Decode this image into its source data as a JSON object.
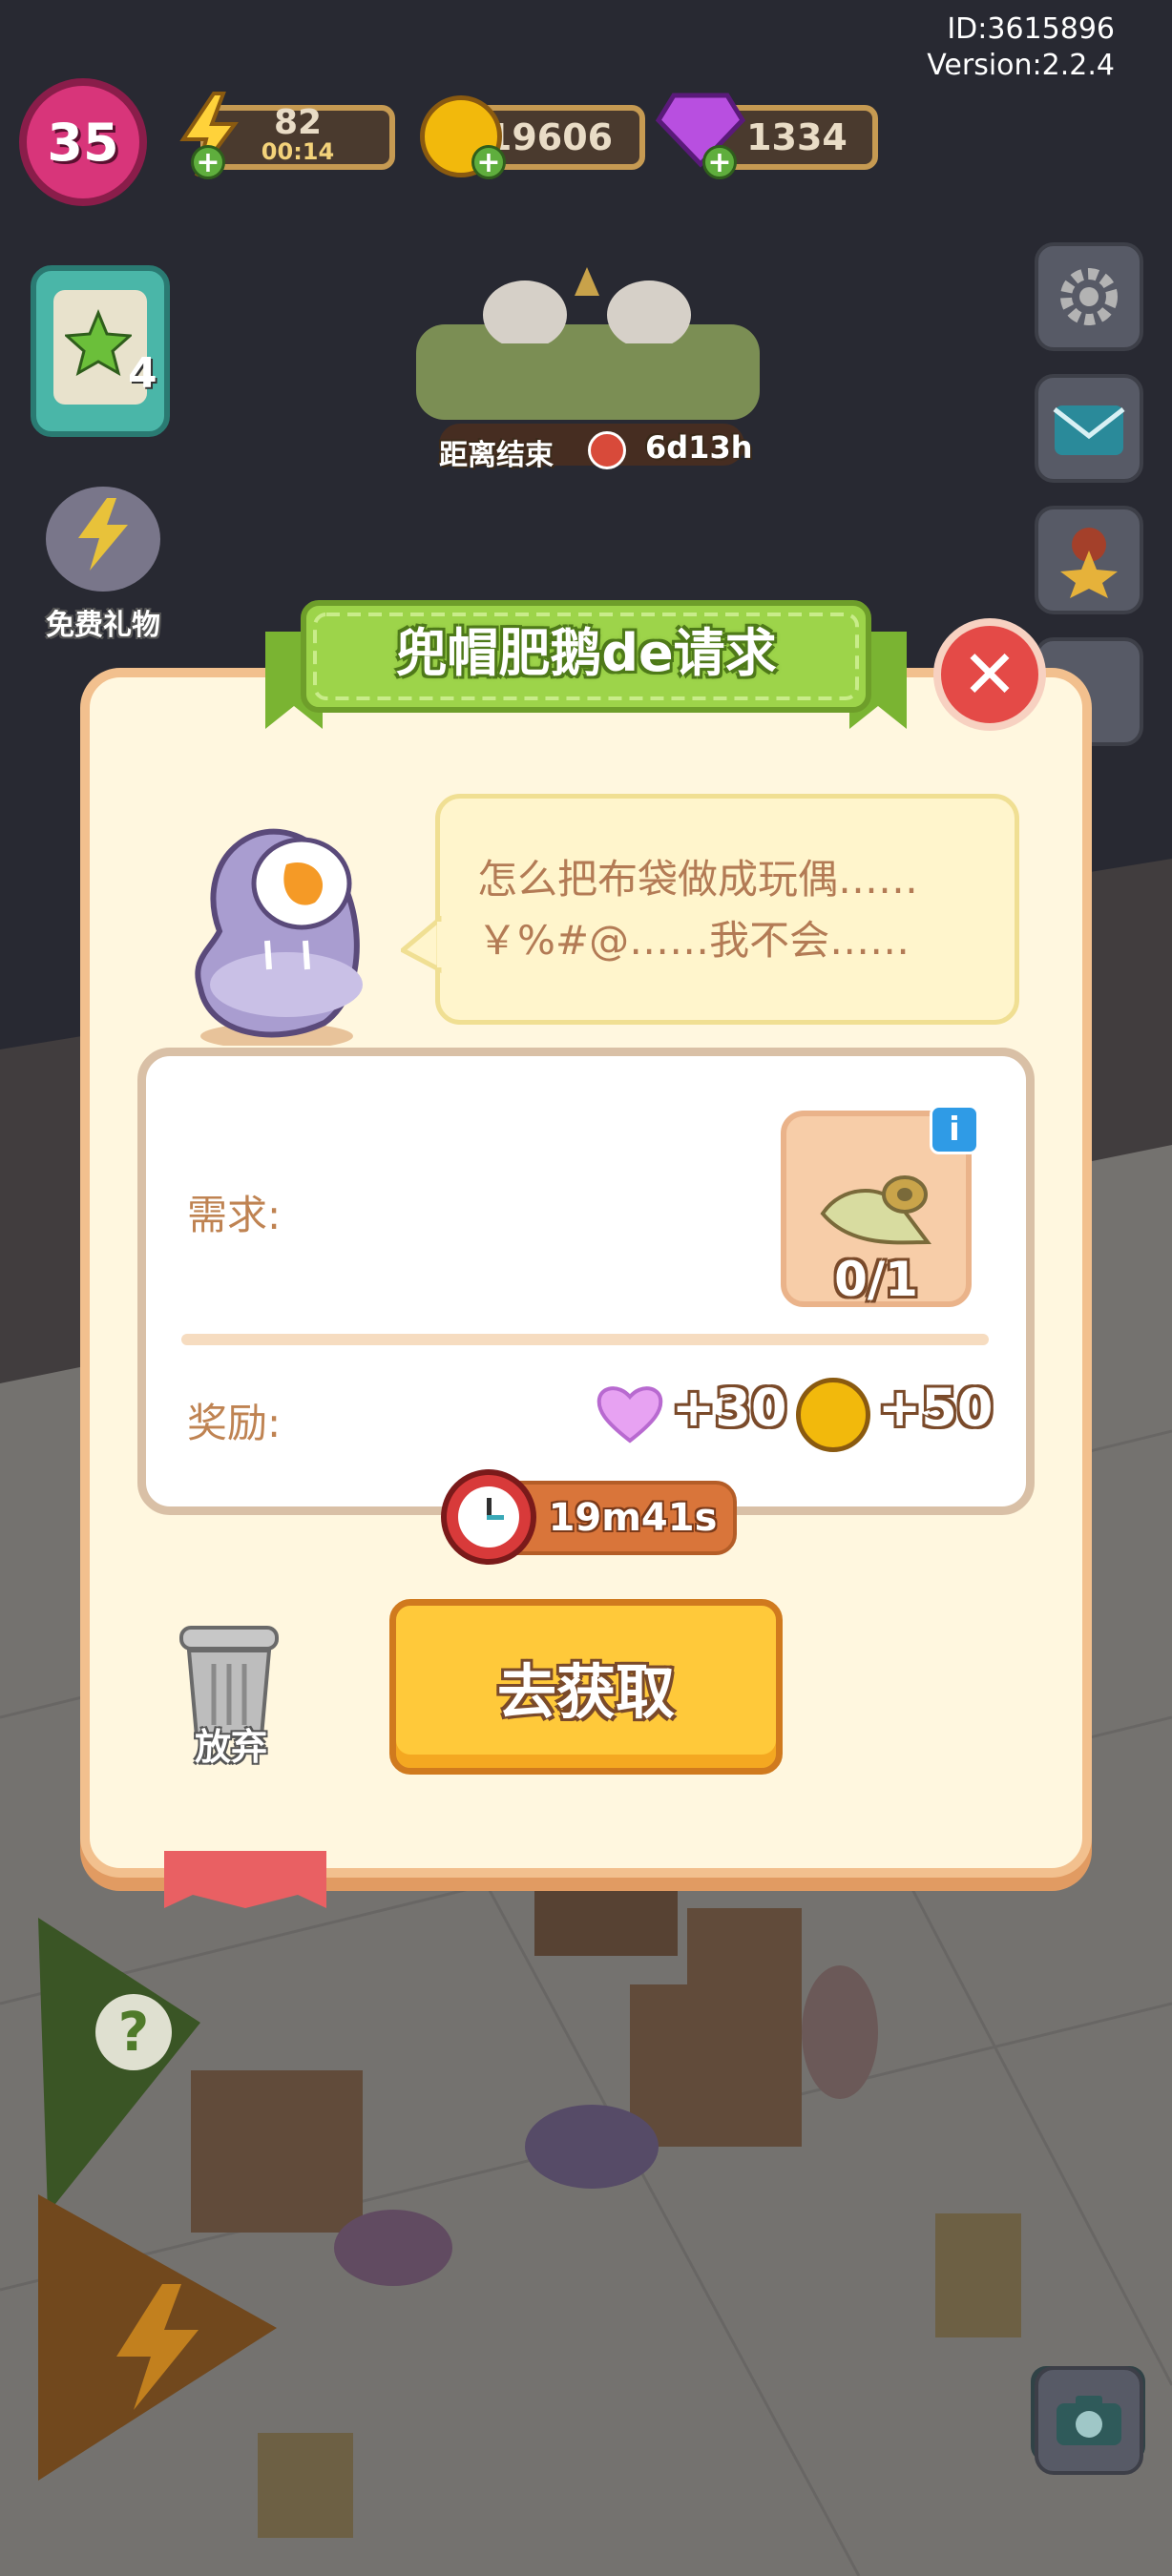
{
  "account": {
    "id": "ID:3615896",
    "version": "Version:2.2.4"
  },
  "hud": {
    "level": "35",
    "energy": "82",
    "energy_timer": "00:14",
    "coins": "19606",
    "gems": "1334",
    "quest_count": "4"
  },
  "event": {
    "countdown_label": "距离结束",
    "countdown_value": "6d13h"
  },
  "free_gift_label": "免费礼物",
  "dialog": {
    "title": "兜帽肥鹅de请求",
    "speech_line1": "怎么把布袋做成玩偶……",
    "speech_line2": "￥%#@……我不会……",
    "demand_label": "需求:",
    "item_progress": "0/1",
    "reward_label": "奖励:",
    "reward_hearts": "+30",
    "reward_coins": "+50",
    "timer": "19m41s",
    "action_button": "去获取",
    "discard_label": "放弃"
  },
  "colors": {
    "panel_bg": "#fff7df",
    "title_ribbon": "#9dd44a",
    "action_button": "#ffc93a",
    "close_button": "#e44a47",
    "text_brown": "#bf8352"
  },
  "icons": [
    "energy-icon",
    "coin-icon",
    "gem-icon",
    "gear-icon",
    "mail-icon",
    "ribbon-star-icon",
    "camera-icon",
    "clock-icon",
    "heart-icon",
    "trash-icon",
    "close-icon",
    "info-icon",
    "cloth-roll-icon"
  ]
}
